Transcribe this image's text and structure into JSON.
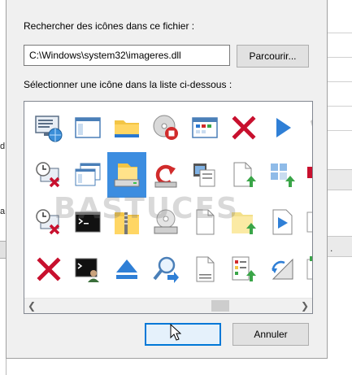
{
  "dialog": {
    "search_label": "Rechercher des icônes dans ce fichier :",
    "file_path": "C:\\Windows\\system32\\imageres.dll",
    "browse_label": "Parcourir...",
    "select_label": "Sélectionner une icône dans la liste ci-dessous :",
    "ok_label": "",
    "cancel_label": "Annuler"
  },
  "background": {
    "left_fragments": [
      "d",
      "a"
    ],
    "right_fragment": "."
  },
  "watermark": {
    "text": "BASTUCES"
  },
  "icon_grid": {
    "columns": 7,
    "rows": 4,
    "selected_index": 16,
    "icons": [
      [
        "monitor-globe-icon",
        "window-icon",
        "folder-icon",
        "disc-stop-icon",
        "calendar-window-icon",
        "red-x-icon",
        "play-arrow-icon"
      ],
      [
        "clock-monitor-x-icon",
        "window-stack-icon",
        "drive-folder-icon",
        "restore-arrow-icon",
        "film-window-icon",
        "document-upload-icon",
        "tiles-upload-icon"
      ],
      [
        "clock-monitor-x-icon",
        "command-prompt-icon",
        "zip-folder-icon",
        "cd-drive-icon",
        "blank-document-icon",
        "folder-upload-icon",
        "video-document-icon"
      ],
      [
        "red-x-icon",
        "admin-command-prompt-icon",
        "eject-icon",
        "magnifier-arrow-icon",
        "document-lines-icon",
        "checklist-upload-icon",
        "triangle-ruler-icon"
      ]
    ]
  },
  "colors": {
    "dialog_bg": "#f0f0f0",
    "selection": "#3c8de0",
    "ok_border": "#0078d7"
  }
}
